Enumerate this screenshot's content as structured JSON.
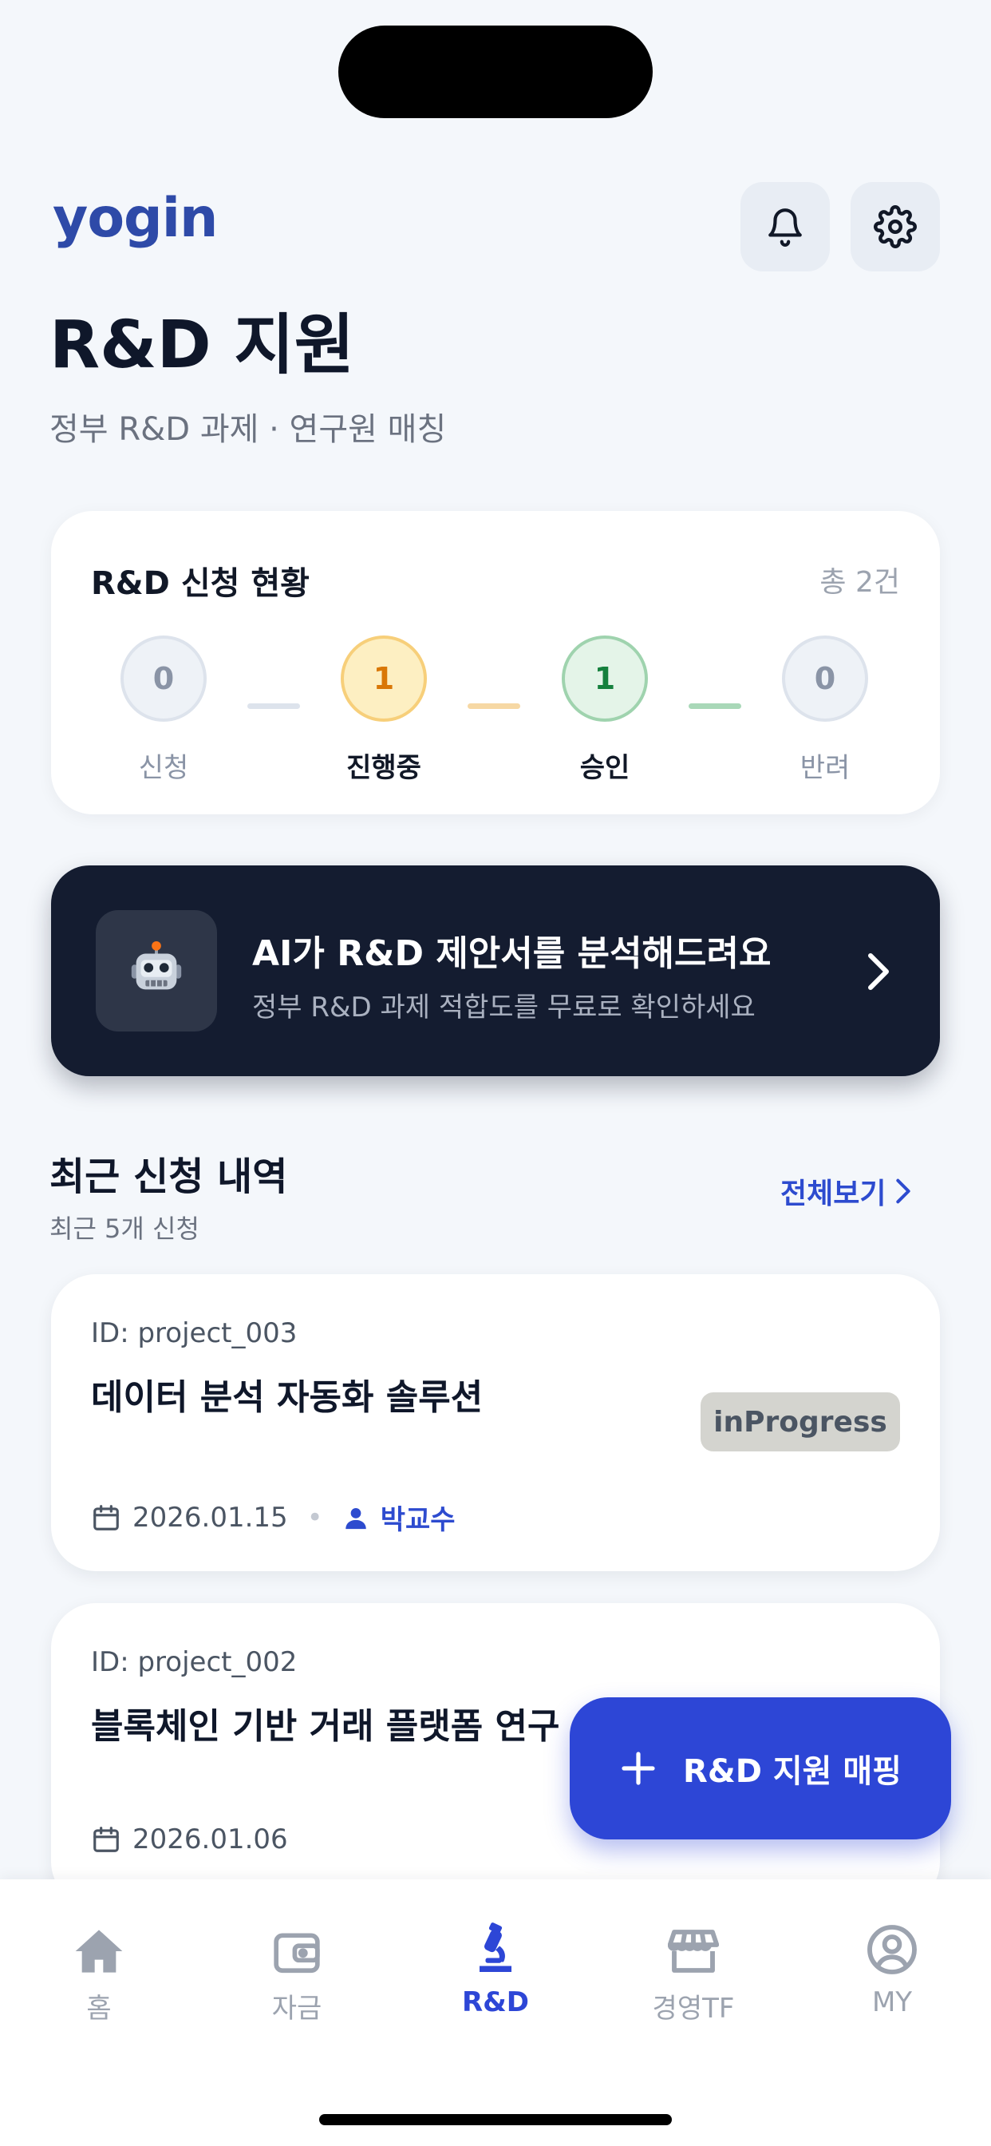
{
  "app": {
    "logo": "yogin"
  },
  "header": {
    "title": "R&D 지원",
    "subtitle": "정부 R&D 과제 · 연구원 매칭"
  },
  "status": {
    "title": "R&D 신청 현황",
    "total": "총 2건",
    "steps": [
      {
        "label": "신청",
        "count": "0",
        "color": "#8A94A6"
      },
      {
        "label": "진행중",
        "count": "1",
        "color": "#D97706"
      },
      {
        "label": "승인",
        "count": "1",
        "color": "#15803D"
      },
      {
        "label": "반려",
        "count": "0",
        "color": "#8A94A6"
      }
    ]
  },
  "ai_banner": {
    "icon": "robot-icon",
    "title": "AI가 R&D 제안서를 분석해드려요",
    "subtitle": "정부 R&D 과제 적합도를 무료로 확인하세요"
  },
  "recent": {
    "title": "최근 신청 내역",
    "subtitle": "최근 5개 신청",
    "view_all": "전체보기",
    "items": [
      {
        "id": "ID: project_003",
        "title": "데이터 분석 자동화 솔루션",
        "status": "inProgress",
        "date": "2026.01.15",
        "professor": "박교수"
      },
      {
        "id": "ID: project_002",
        "title": "블록체인 기반 거래 플랫폼 연구",
        "date": "2026.01.06"
      }
    ]
  },
  "fab": {
    "label": "R&D 지원 매핑"
  },
  "tabs": [
    {
      "label": "홈",
      "icon": "home-icon"
    },
    {
      "label": "자금",
      "icon": "wallet-icon"
    },
    {
      "label": "R&D",
      "icon": "microscope-icon",
      "active": true
    },
    {
      "label": "경영TF",
      "icon": "store-icon"
    },
    {
      "label": "MY",
      "icon": "user-circle-icon"
    }
  ],
  "colors": {
    "primary": "#2D46D6",
    "dark_banner": "#141C30",
    "background": "#F4F7FB"
  }
}
